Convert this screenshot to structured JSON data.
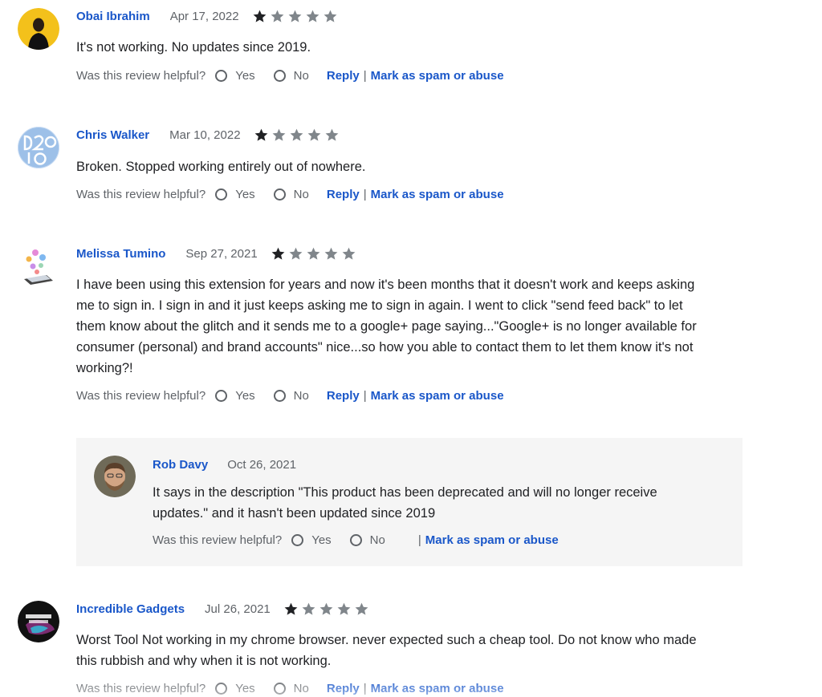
{
  "helpful_label": "Was this review helpful?",
  "yes_label": "Yes",
  "no_label": "No",
  "reply_label": "Reply",
  "spam_label": "Mark as spam or abuse",
  "separator": "|",
  "colors": {
    "link": "#1a57c9",
    "muted": "#5f6368",
    "reply_bg": "#f5f5f5",
    "star_filled": "#202124",
    "star_empty": "#80868b"
  },
  "reviews": [
    {
      "author": "Obai Ibrahim",
      "date": "Apr 17, 2022",
      "rating": 1,
      "max_rating": 5,
      "text": "It's not working. No updates since 2019."
    },
    {
      "author": "Chris Walker",
      "date": "Mar 10, 2022",
      "rating": 1,
      "max_rating": 5,
      "text": "Broken. Stopped working entirely out of nowhere."
    },
    {
      "author": "Melissa Tumino",
      "date": "Sep 27, 2021",
      "rating": 1,
      "max_rating": 5,
      "text_lines": [
        "I have been using this extension for years and now it's been months that it doesn't work and keeps asking",
        "me to sign in. I sign in and it just keeps asking me to sign in again. I went to click \"send feed back\" to let",
        "them know about the glitch and it sends me to a google+ page saying...\"Google+ is no longer available for",
        "consumer (personal) and brand accounts\" nice...so how you able to contact them to let them know it's not",
        "working?!"
      ]
    },
    {
      "author": "Incredible Gadgets",
      "date": "Jul 26, 2021",
      "rating": 1,
      "max_rating": 5,
      "text_lines": [
        "Worst Tool Not working in my chrome browser. never expected such a cheap tool. Do not know who made",
        "this rubbish and why when it is not working."
      ]
    }
  ],
  "reply": {
    "author": "Rob Davy",
    "date": "Oct 26, 2021",
    "text_lines": [
      "It says in the description \"This product has been deprecated and will no longer receive",
      "updates.\" and it hasn't been updated since 2019"
    ]
  }
}
